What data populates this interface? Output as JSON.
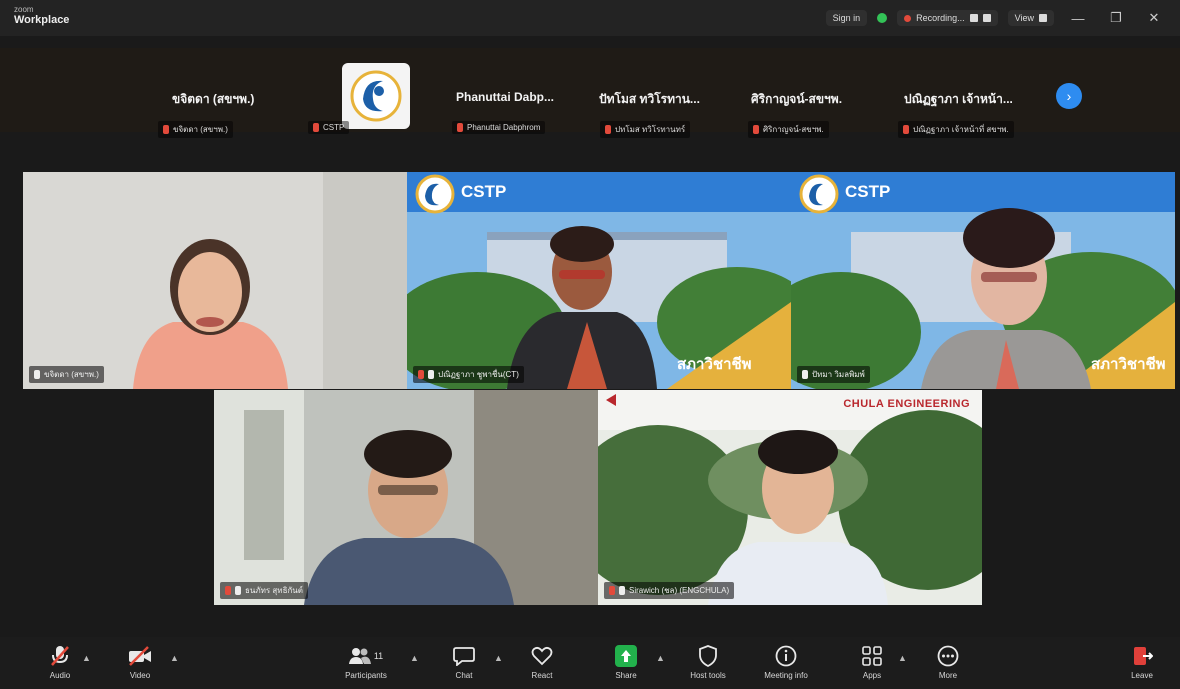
{
  "titlebar": {
    "app_line1": "zoom",
    "app_line2": "Workplace",
    "sign_in": "Sign in",
    "recording": "Recording...",
    "view": "View"
  },
  "strip": {
    "participants": [
      {
        "name": "ขจิตดา (สขฯพ.)",
        "tag": "ขจิตดา (สขฯพ.)"
      },
      {
        "name": "",
        "tag": "CSTP"
      },
      {
        "name": "Phanuttai Dabp...",
        "tag": "Phanuttai Dabphrom"
      },
      {
        "name": "ปัทโมส ทวิโรทาน...",
        "tag": "ปทโมส ทวิโรทานทร์"
      },
      {
        "name": "ศิริกาญจน์-สขฯพ.",
        "tag": "ศิริกาญจน์-สขฯพ."
      },
      {
        "name": "ปณิฏฐาภา เจ้าหน้า...",
        "tag": "ปณิฏฐาภา เจ้าหน้าที่ สขฯพ."
      }
    ]
  },
  "grid": {
    "tiles": [
      {
        "tag": "ขจิตดา (สขฯพ.)",
        "banner": ""
      },
      {
        "tag": "ปณิฏฐาภา ชูพาชื่น(CT)",
        "banner": "CSTP",
        "caption": "สภาวิชาชีพ"
      },
      {
        "tag": "ปัทมา วิมลพิมพ์",
        "banner": "CSTP",
        "caption": "สภาวิชาชีพ"
      },
      {
        "tag": "ธนภัทร สุทธิกันต์",
        "banner": ""
      },
      {
        "tag": "Sirawich (ชล) (ENGCHULA)",
        "banner": "CHULA ENGINEERING"
      }
    ]
  },
  "toolbar": {
    "audio": "Audio",
    "video": "Video",
    "participants": "Participants",
    "participants_count": "11",
    "chat": "Chat",
    "react": "React",
    "share": "Share",
    "host_tools": "Host tools",
    "meeting_info": "Meeting info",
    "apps": "Apps",
    "more": "More",
    "leave": "Leave"
  },
  "colors": {
    "active_speaker": "#3ad07a",
    "share_green": "#22b14c",
    "leave_red": "#e0403a",
    "accent_blue": "#2e8cf0"
  }
}
